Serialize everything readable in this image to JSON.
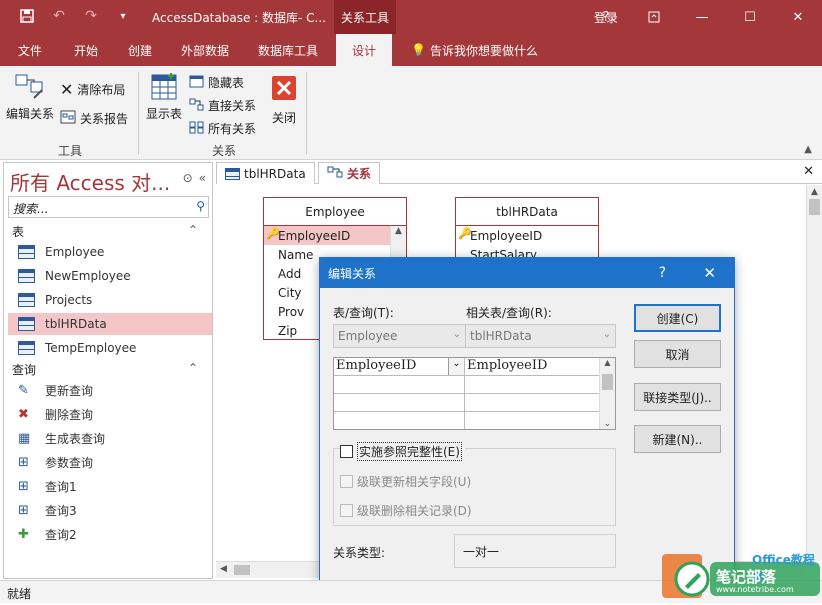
{
  "titlebar": {
    "title": "AccessDatabase : 数据库- C...",
    "context_tab": "关系工具",
    "login": "登录",
    "help": "?",
    "qat": {
      "save_icon": "save-icon",
      "undo_icon": "undo-icon",
      "redo_icon": "redo-icon",
      "custom_icon": "qat-dropdown-icon"
    }
  },
  "ribbon_tabs": [
    "文件",
    "开始",
    "创建",
    "外部数据",
    "数据库工具",
    "设计"
  ],
  "tell_me": "告诉我你想要做什么",
  "ribbon": {
    "tools": {
      "edit_relationships": "编辑关系",
      "clear_layout": "清除布局",
      "relationship_report": "关系报告",
      "group_label": "工具"
    },
    "relationships": {
      "show_table": "显示表",
      "hide_table": "隐藏表",
      "direct_relationships": "直接关系",
      "all_relationships": "所有关系",
      "close": "关闭",
      "group_label": "关系"
    }
  },
  "nav": {
    "header": "所有 Access 对...",
    "search_placeholder": "搜索...",
    "tables_section": "表",
    "tables": [
      "Employee",
      "NewEmployee",
      "Projects",
      "tblHRData",
      "TempEmployee"
    ],
    "selected_table": "tblHRData",
    "queries_section": "查询",
    "queries": [
      "更新查询",
      "删除查询",
      "生成表查询",
      "参数查询",
      "查询1",
      "查询3",
      "查询2"
    ]
  },
  "doc_tabs": [
    "tblHRData",
    "关系"
  ],
  "canvas": {
    "employee_table": {
      "title": "Employee",
      "fields": [
        "EmployeeID",
        "Name",
        "Add",
        "City",
        "Prov",
        "Zip"
      ]
    },
    "hr_table": {
      "title": "tblHRData",
      "fields": [
        "EmployeeID",
        "StartSalary"
      ]
    }
  },
  "dialog": {
    "title": "编辑关系",
    "help": "?",
    "table_query_label": "表/查询(T):",
    "related_table_label": "相关表/查询(R):",
    "table_value": "Employee",
    "related_value": "tblHRData",
    "grid_left": "EmployeeID",
    "grid_right": "EmployeeID",
    "create_button": "创建(C)",
    "cancel_button": "取消",
    "join_type_button": "联接类型(J)..",
    "new_button": "新建(N)..",
    "enforce_integrity": "实施参照完整性(E)",
    "cascade_update": "级联更新相关字段(U)",
    "cascade_delete": "级联删除相关记录(D)",
    "relationship_type_label": "关系类型:",
    "relationship_type_value": "一对一"
  },
  "status": {
    "text": "就绪"
  },
  "watermark": {
    "text": "笔记部落",
    "sub": "www.notetribe.com",
    "site": "Office教程网"
  },
  "colors": {
    "accent": "#a4373a",
    "dialog_blue": "#1e72c9",
    "selection": "#f4c6c7"
  }
}
